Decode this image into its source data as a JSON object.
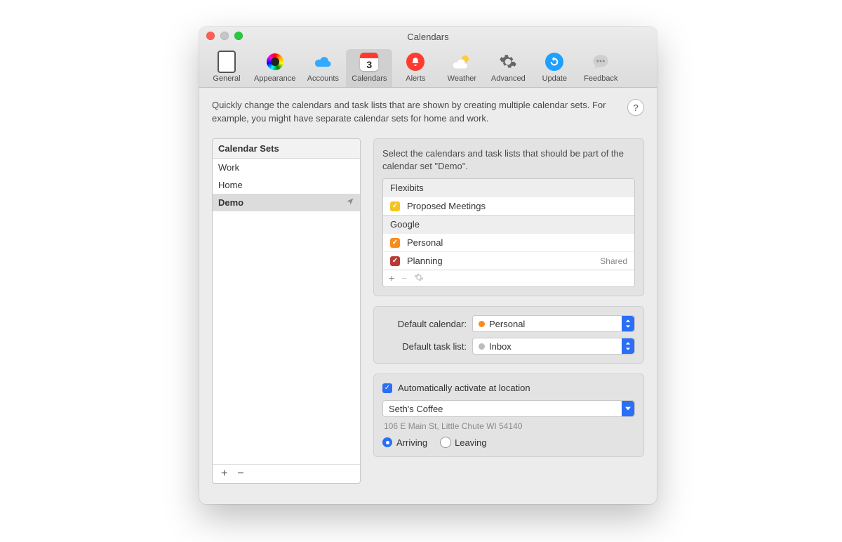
{
  "window": {
    "title": "Calendars"
  },
  "toolbar": {
    "items": [
      {
        "id": "general",
        "label": "General"
      },
      {
        "id": "appearance",
        "label": "Appearance"
      },
      {
        "id": "accounts",
        "label": "Accounts"
      },
      {
        "id": "calendars",
        "label": "Calendars"
      },
      {
        "id": "alerts",
        "label": "Alerts"
      },
      {
        "id": "weather",
        "label": "Weather"
      },
      {
        "id": "advanced",
        "label": "Advanced"
      },
      {
        "id": "update",
        "label": "Update"
      },
      {
        "id": "feedback",
        "label": "Feedback"
      }
    ],
    "active": "calendars",
    "calendar_icon_day": "3"
  },
  "description": "Quickly change the calendars and task lists that are shown by creating multiple calendar sets. For example, you might have separate calendar sets for home and work.",
  "help_symbol": "?",
  "sets_panel": {
    "header": "Calendar Sets",
    "items": [
      "Work",
      "Home",
      "Demo"
    ],
    "selected": "Demo",
    "add": "+",
    "remove": "−"
  },
  "right": {
    "desc_prefix": "Select the calendars and task lists that should be part of the calendar set \"",
    "desc_set": "Demo",
    "desc_suffix": "\".",
    "groups": [
      {
        "name": "Flexibits",
        "items": [
          {
            "label": "Proposed Meetings",
            "color": "#f5c324",
            "checked": true,
            "badge": ""
          }
        ]
      },
      {
        "name": "Google",
        "items": [
          {
            "label": "Personal",
            "color": "#fb8b1e",
            "checked": true,
            "badge": ""
          },
          {
            "label": "Planning",
            "color": "#b93a33",
            "checked": true,
            "badge": "Shared"
          }
        ]
      }
    ],
    "footer": {
      "add": "+",
      "remove": "−",
      "gear": "⚙"
    }
  },
  "defaults": {
    "calendar_label": "Default calendar:",
    "calendar_value": "Personal",
    "calendar_color": "#fb8b1e",
    "tasklist_label": "Default task list:",
    "tasklist_value": "Inbox",
    "tasklist_color": "#bcbcbc"
  },
  "location": {
    "auto_label": "Automatically activate at location",
    "auto_checked": true,
    "place": "Seth's Coffee",
    "address": "106 E Main St, Little Chute WI 54140",
    "arriving_label": "Arriving",
    "leaving_label": "Leaving",
    "selected": "arriving"
  }
}
